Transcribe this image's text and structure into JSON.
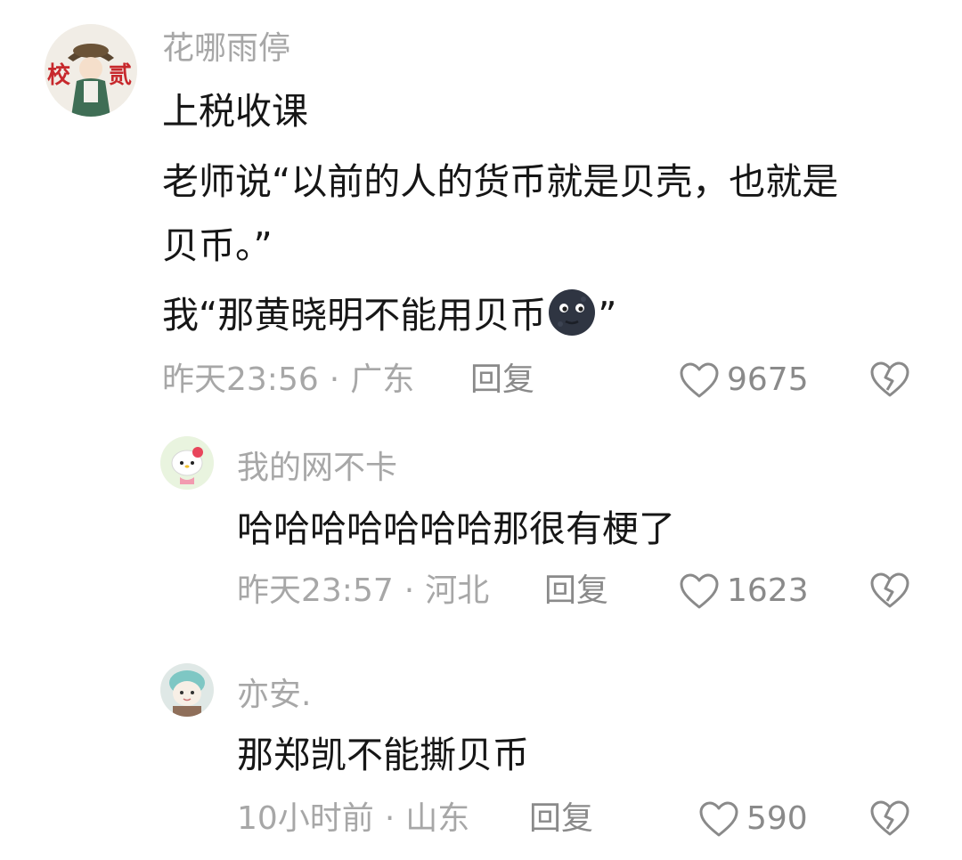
{
  "comments": [
    {
      "username": "花哪雨停",
      "avatar_text": "校 贰",
      "lines": [
        "上税收课",
        "老师说“以前的人的货币就是贝壳，也就是",
        "贝币。”",
        "我“那黄晓明不能用贝币"
      ],
      "line4_tail": "”",
      "emoji": "new-moon-face-emoji",
      "time": "昨天23:56",
      "location": "广东",
      "reply_label": "回复",
      "likes": "9675"
    },
    {
      "username": "我的网不卡",
      "text": "哈哈哈哈哈哈哈那很有梗了",
      "time": "昨天23:57",
      "location": "河北",
      "reply_label": "回复",
      "likes": "1623"
    },
    {
      "username": "亦安.",
      "text": "那郑凯不能撕贝币",
      "time": "10小时前",
      "location": "山东",
      "reply_label": "回复",
      "likes": "590"
    }
  ],
  "separator": "·",
  "icons": {
    "like": "heart-outline-icon",
    "dislike": "broken-heart-icon"
  },
  "colors": {
    "username": "#a7a7a7",
    "text": "#161616",
    "meta": "#a7a7a7",
    "icon": "#8a8a8a"
  }
}
